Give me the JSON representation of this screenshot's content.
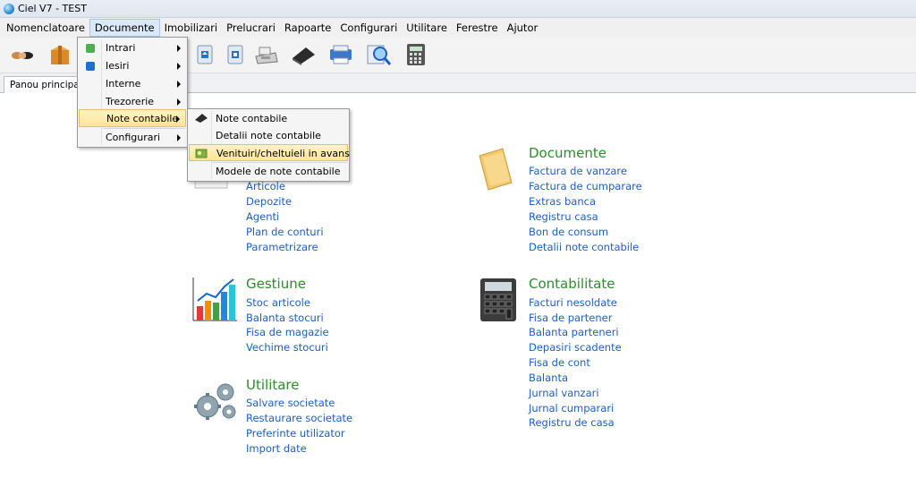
{
  "window": {
    "title": "Ciel V7 - TEST"
  },
  "menubar": {
    "items": [
      "Nomenclatoare",
      "Documente",
      "Imobilizari",
      "Prelucrari",
      "Rapoarte",
      "Configurari",
      "Utilitare",
      "Ferestre",
      "Ajutor"
    ],
    "active": "Documente"
  },
  "toolbar": {
    "icons": [
      "handshake-icon",
      "box-icon",
      "upload-document-icon",
      "export-document-icon",
      "cash-register-icon",
      "receipt-printer-icon",
      "printer-icon",
      "search-document-icon",
      "calculator-icon"
    ]
  },
  "tabs": {
    "active_label": "Panou principal"
  },
  "documente_menu": {
    "items": [
      "Intrari",
      "Iesiri",
      "Interne",
      "Trezorerie",
      "Note contabile",
      "Configurari"
    ],
    "highlighted": "Note contabile"
  },
  "note_contabile_submenu": {
    "items": [
      "Note contabile",
      "Detalii note contabile",
      "Venituiri/cheltuieli in avans",
      "Modele de note contabile"
    ],
    "highlighted": "Venituiri/cheltuieli in avans"
  },
  "panel": {
    "nomenclatoare": {
      "links": [
        "Articole",
        "Depozite",
        "Agenti",
        "Plan de conturi",
        "Parametrizare"
      ]
    },
    "documente": {
      "title": "Documente",
      "links": [
        "Factura de vanzare",
        "Factura de cumparare",
        "Extras banca",
        "Registru casa",
        "Bon de consum",
        "Detalii note contabile"
      ]
    },
    "gestiune": {
      "title": "Gestiune",
      "links": [
        "Stoc articole",
        "Balanta stocuri",
        "Fisa de magazie",
        "Vechime stocuri"
      ]
    },
    "contabilitate": {
      "title": "Contabilitate",
      "links": [
        "Facturi nesoldate",
        "Fisa de partener",
        "Balanta parteneri",
        "Depasiri scadente",
        "Fisa de cont",
        "Balanta",
        "Jurnal vanzari",
        "Jurnal cumparari",
        "Registru de casa"
      ]
    },
    "utilitare": {
      "title": "Utilitare",
      "links": [
        "Salvare societate",
        "Restaurare societate",
        "Preferinte utilizator",
        "Import date"
      ]
    }
  },
  "colors": {
    "section_title": "#2e8b2e",
    "link": "#1f5fbf",
    "menu_highlight": "#fde598"
  }
}
